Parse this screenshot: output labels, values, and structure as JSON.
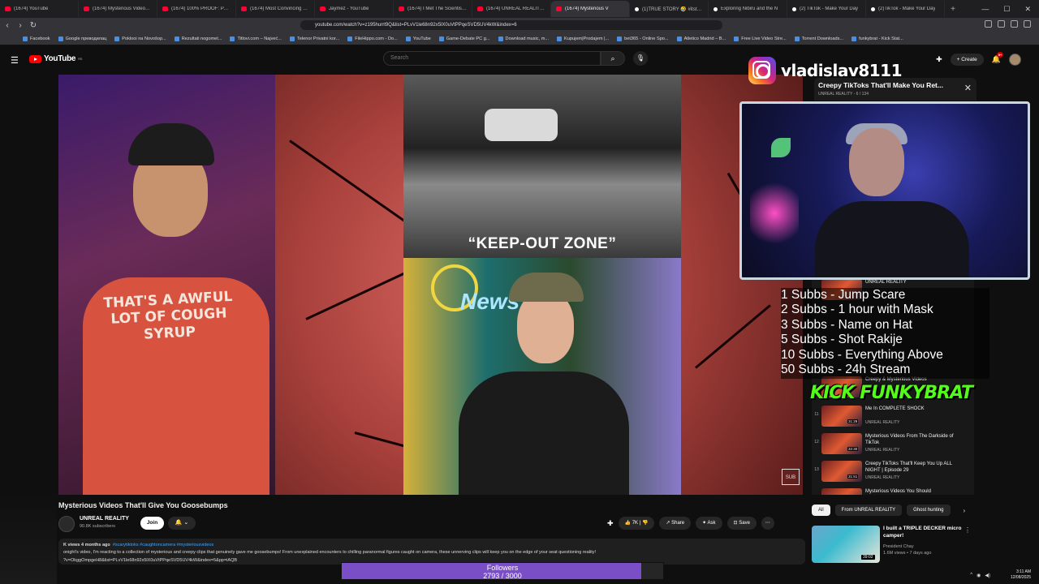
{
  "browser": {
    "tabs": [
      {
        "label": "(1674) YouTube",
        "icon": "youtube-icon"
      },
      {
        "label": "(1674) Mysterious Videos Y",
        "icon": "youtube-icon"
      },
      {
        "label": "(1674) 100% PROOF: PARA",
        "icon": "youtube-icon"
      },
      {
        "label": "(1674) Most Convincing Evi",
        "icon": "youtube-icon"
      },
      {
        "label": "Jaymez - YouTube",
        "icon": "youtube-icon"
      },
      {
        "label": "(1674) I Met The Scientist T",
        "icon": "youtube-icon"
      },
      {
        "label": "(1674) UNREAL REALITY - Y",
        "icon": "youtube-icon"
      },
      {
        "label": "(1674) Mysterious V",
        "icon": "youtube-icon",
        "active": true
      },
      {
        "label": "(1)TRUE STORY 🤣 #itstent",
        "icon": "tiktok-icon"
      },
      {
        "label": "Exploring Nibiru and the N",
        "icon": "tiktok-icon"
      },
      {
        "label": "(2) TikTok - Make Your Day",
        "icon": "tiktok-icon"
      },
      {
        "label": "(2)TikTok - Make Your Day",
        "icon": "tiktok-icon"
      }
    ],
    "url": "youtube.com/watch?v=z195hurrt9Q&list=PLvV1le68n92x5lX0uVtPPqeSVD5UV4kW&index=6",
    "bookmarks": [
      "Facebook",
      "Google преводилац",
      "Poklooi na Novošop...",
      "Rezultati nogomet...",
      "Titlovi.com – Najveć...",
      "Telenor Privatni kor...",
      "FileHippo.com - Do...",
      "YouTube",
      "Game-Debate PC g...",
      "Download music, m...",
      "Kupujem|Prodajem |...",
      "bet365 - Online Spo...",
      "Atletico Madrid – B...",
      "Free Live Video Stre...",
      "Torrent Downloads...",
      "funkybrat - Kick Stat..."
    ]
  },
  "youtube": {
    "logo": "YouTube",
    "logo_sup": "RS",
    "search_placeholder": "Search",
    "create_label": "Create",
    "notif_count": "9+"
  },
  "video": {
    "caption": "“KEEP-OUT ZONE”",
    "shirt_text": "THAT'S A AWFUL LOT OF COUGH SYRUP",
    "title": "Mysterious Videos That'll Give You Goosebumps",
    "channel": "UNREAL REALITY",
    "subscribers": "90.8K subscribers",
    "join_label": "Join",
    "likes": "7K",
    "share_label": "Share",
    "ask_label": "Ask",
    "save_label": "Save",
    "desc_meta": "K views  4 months ago",
    "desc_tags": "#scarytiktoks #caughtoncamera #mysteriousvideos",
    "desc_text": "onight's video, I'm reacting to a collection of mysterious and creepy clips that genuinely gave me goosebumps! From unexplained encounters to chilling paranormal figures caught on camera, these unnerving clips will keep you on the edge of your seat questioning reality!",
    "desc_link": "?v=OkggOmpgeH8&list=PLvV1le68n92x5lX0uVtPPqeSVD5UV4kW&index=5&pp=iAQB"
  },
  "overlay": {
    "instagram_handle": "vladislav8111",
    "rewards": [
      "1 Subbs - Jump Scare",
      "2 Subbs - 1 hour with Mask",
      "3 Subbs - Name on Hat",
      "5 Subbs - Shot Rakije",
      "10 Subbs - Everything Above",
      "50 Subbs - 24h Stream"
    ],
    "kick_label": "KICK FUNKYBRAT",
    "followers_label": "Followers",
    "followers_count": "2793 / 3000",
    "followers_fraction": 0.931
  },
  "playlist": {
    "title": "Creepy TikToks That'll Make You Ret...",
    "channel": "UNREAL REALITY - 6 / 134",
    "items": [
      {
        "num": "",
        "title": "UNREAL REALITY",
        "channel": "",
        "duration": ""
      },
      {
        "num": "",
        "title": "Creepy & Mysterious Videos",
        "channel": "",
        "duration": ""
      },
      {
        "num": "11",
        "title": "Me In COMPLETE SHOCK",
        "channel": "UNREAL REALITY",
        "duration": "31:29"
      },
      {
        "num": "12",
        "title": "Mysterious Videos From The Darkside of TikTok",
        "channel": "UNREAL REALITY",
        "duration": "32:30"
      },
      {
        "num": "13",
        "title": "Creepy TikToks That'll Keep You Up ALL NIGHT | Episode 29",
        "channel": "UNREAL REALITY",
        "duration": "31:51"
      },
      {
        "num": "",
        "title": "Mysterious Videos You Should",
        "channel": "",
        "duration": ""
      }
    ]
  },
  "chips": [
    "All",
    "From UNREAL REALITY",
    "Ghost hunting"
  ],
  "recommendation": {
    "title": "I built a TRIPLE DECKER micro camper!",
    "channel": "President Chay",
    "meta": "1.6M views • 7 days ago",
    "duration": "39:02"
  },
  "system": {
    "time": "3:11 AM",
    "date": "12/08/2025"
  }
}
